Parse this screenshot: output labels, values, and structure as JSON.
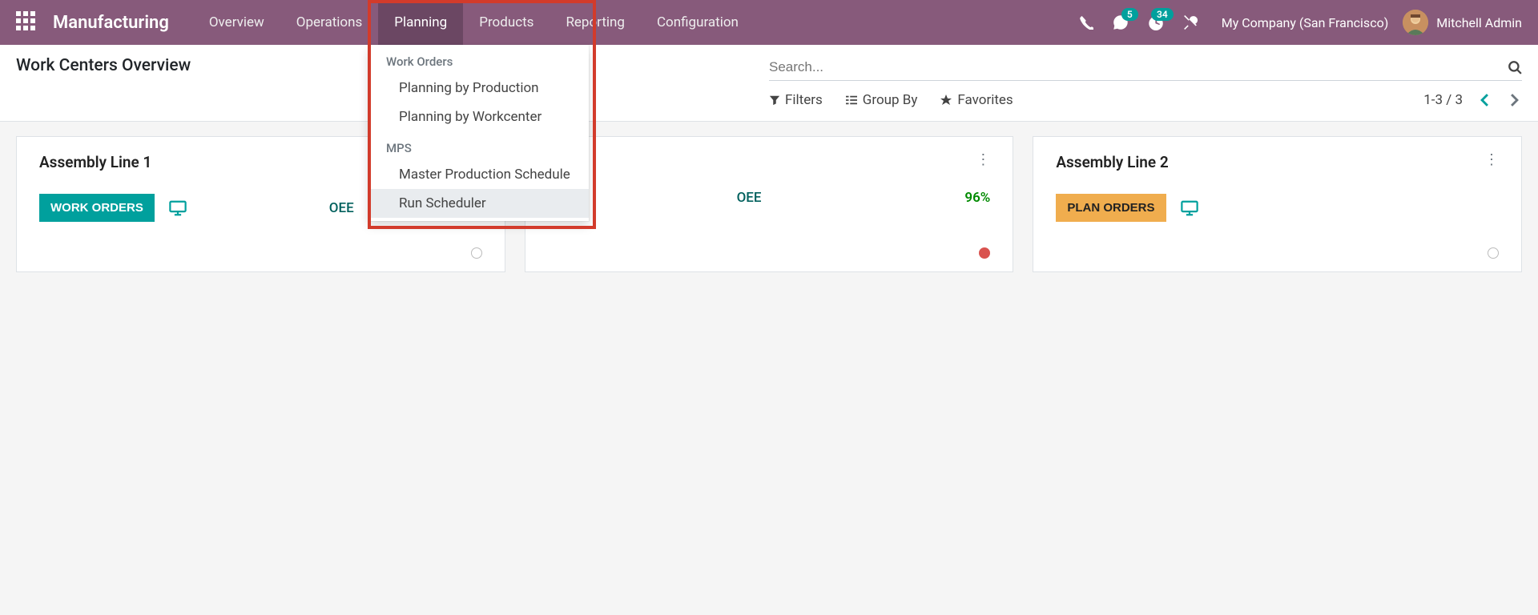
{
  "header": {
    "app_title": "Manufacturing",
    "nav": [
      "Overview",
      "Operations",
      "Planning",
      "Products",
      "Reporting",
      "Configuration"
    ],
    "active_nav": "Planning",
    "chat_badge": "5",
    "activity_badge": "34",
    "company": "My Company (San Francisco)",
    "user": "Mitchell Admin"
  },
  "dropdown": {
    "section1_label": "Work Orders",
    "items1": [
      "Planning by Production",
      "Planning by Workcenter"
    ],
    "section2_label": "MPS",
    "items2": [
      "Master Production Schedule"
    ],
    "items3": [
      "Run Scheduler"
    ],
    "highlighted": "Run Scheduler"
  },
  "control_panel": {
    "title": "Work Centers Overview",
    "search_placeholder": "Search...",
    "filters_label": "Filters",
    "groupby_label": "Group By",
    "favorites_label": "Favorites",
    "pager": "1-3 / 3"
  },
  "cards": [
    {
      "title": "Assembly Line 1",
      "button": "WORK ORDERS",
      "button_type": "work",
      "oee_label": "OEE",
      "oee_value": "",
      "dot": "grey"
    },
    {
      "title": "",
      "button": "",
      "button_type": "",
      "oee_label": "OEE",
      "oee_value": "96%",
      "dot": "red"
    },
    {
      "title": "Assembly Line 2",
      "button": "PLAN ORDERS",
      "button_type": "plan",
      "oee_label": "",
      "oee_value": "",
      "dot": "grey"
    }
  ]
}
